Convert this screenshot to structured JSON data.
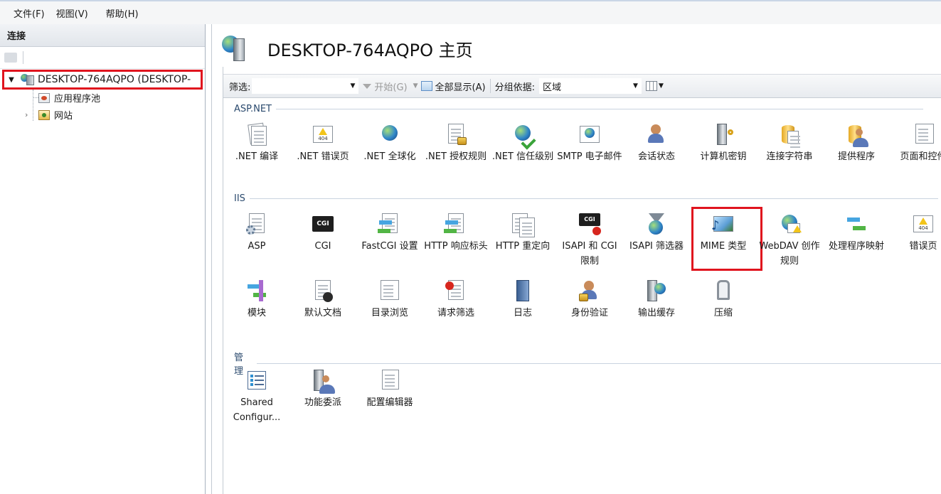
{
  "menu": [
    "文件(F)",
    "视图(V)",
    "帮助(H)"
  ],
  "connections": {
    "title": "连接",
    "root": "DESKTOP-764AQPO (DESKTOP-",
    "children": [
      "应用程序池",
      "网站"
    ]
  },
  "page": {
    "title": "DESKTOP-764AQPO 主页"
  },
  "filterbar": {
    "filter_label": "筛选:",
    "filter_value": "",
    "start_label": "开始(G)",
    "show_all_label": "全部显示(A)",
    "group_by_label": "分组依据:",
    "group_by_value": "区域"
  },
  "sections": [
    {
      "name": "ASP.NET",
      "items": [
        {
          "label": ".NET 编译",
          "icon": "compile-icon"
        },
        {
          "label": ".NET 错误页",
          "icon": "error-page-icon"
        },
        {
          "label": ".NET 全球化",
          "icon": "globe-icon"
        },
        {
          "label": ".NET 授权规则",
          "icon": "auth-rules-icon"
        },
        {
          "label": ".NET 信任级别",
          "icon": "trust-level-icon"
        },
        {
          "label": "SMTP 电子邮件",
          "icon": "smtp-icon"
        },
        {
          "label": "会话状态",
          "icon": "session-icon"
        },
        {
          "label": "计算机密钥",
          "icon": "machine-key-icon"
        },
        {
          "label": "连接字符串",
          "icon": "connection-string-icon"
        },
        {
          "label": "提供程序",
          "icon": "providers-icon"
        },
        {
          "label": "页面和控件",
          "icon": "pages-controls-icon"
        }
      ]
    },
    {
      "name": "IIS",
      "items": [
        {
          "label": "ASP",
          "icon": "asp-icon"
        },
        {
          "label": "CGI",
          "icon": "cgi-icon"
        },
        {
          "label": "FastCGI 设置",
          "icon": "fastcgi-icon"
        },
        {
          "label": "HTTP 响应标头",
          "icon": "http-headers-icon"
        },
        {
          "label": "HTTP 重定向",
          "icon": "http-redirect-icon"
        },
        {
          "label": "ISAPI 和 CGI 限制",
          "icon": "isapi-cgi-icon"
        },
        {
          "label": "ISAPI 筛选器",
          "icon": "isapi-filter-icon"
        },
        {
          "label": "MIME 类型",
          "icon": "mime-icon"
        },
        {
          "label": "WebDAV 创作规则",
          "icon": "webdav-icon"
        },
        {
          "label": "处理程序映射",
          "icon": "handler-mapping-icon"
        },
        {
          "label": "错误页",
          "icon": "error-page-icon"
        },
        {
          "label": "模块",
          "icon": "modules-icon"
        },
        {
          "label": "默认文档",
          "icon": "default-document-icon"
        },
        {
          "label": "目录浏览",
          "icon": "directory-browsing-icon"
        },
        {
          "label": "请求筛选",
          "icon": "request-filtering-icon"
        },
        {
          "label": "日志",
          "icon": "logging-icon"
        },
        {
          "label": "身份验证",
          "icon": "authentication-icon"
        },
        {
          "label": "输出缓存",
          "icon": "output-cache-icon"
        },
        {
          "label": "压缩",
          "icon": "compression-icon"
        }
      ]
    },
    {
      "name": "管理",
      "items": [
        {
          "label": "Shared Configur...",
          "icon": "shared-config-icon"
        },
        {
          "label": "功能委派",
          "icon": "feature-delegation-icon"
        },
        {
          "label": "配置编辑器",
          "icon": "config-editor-icon"
        }
      ]
    }
  ]
}
